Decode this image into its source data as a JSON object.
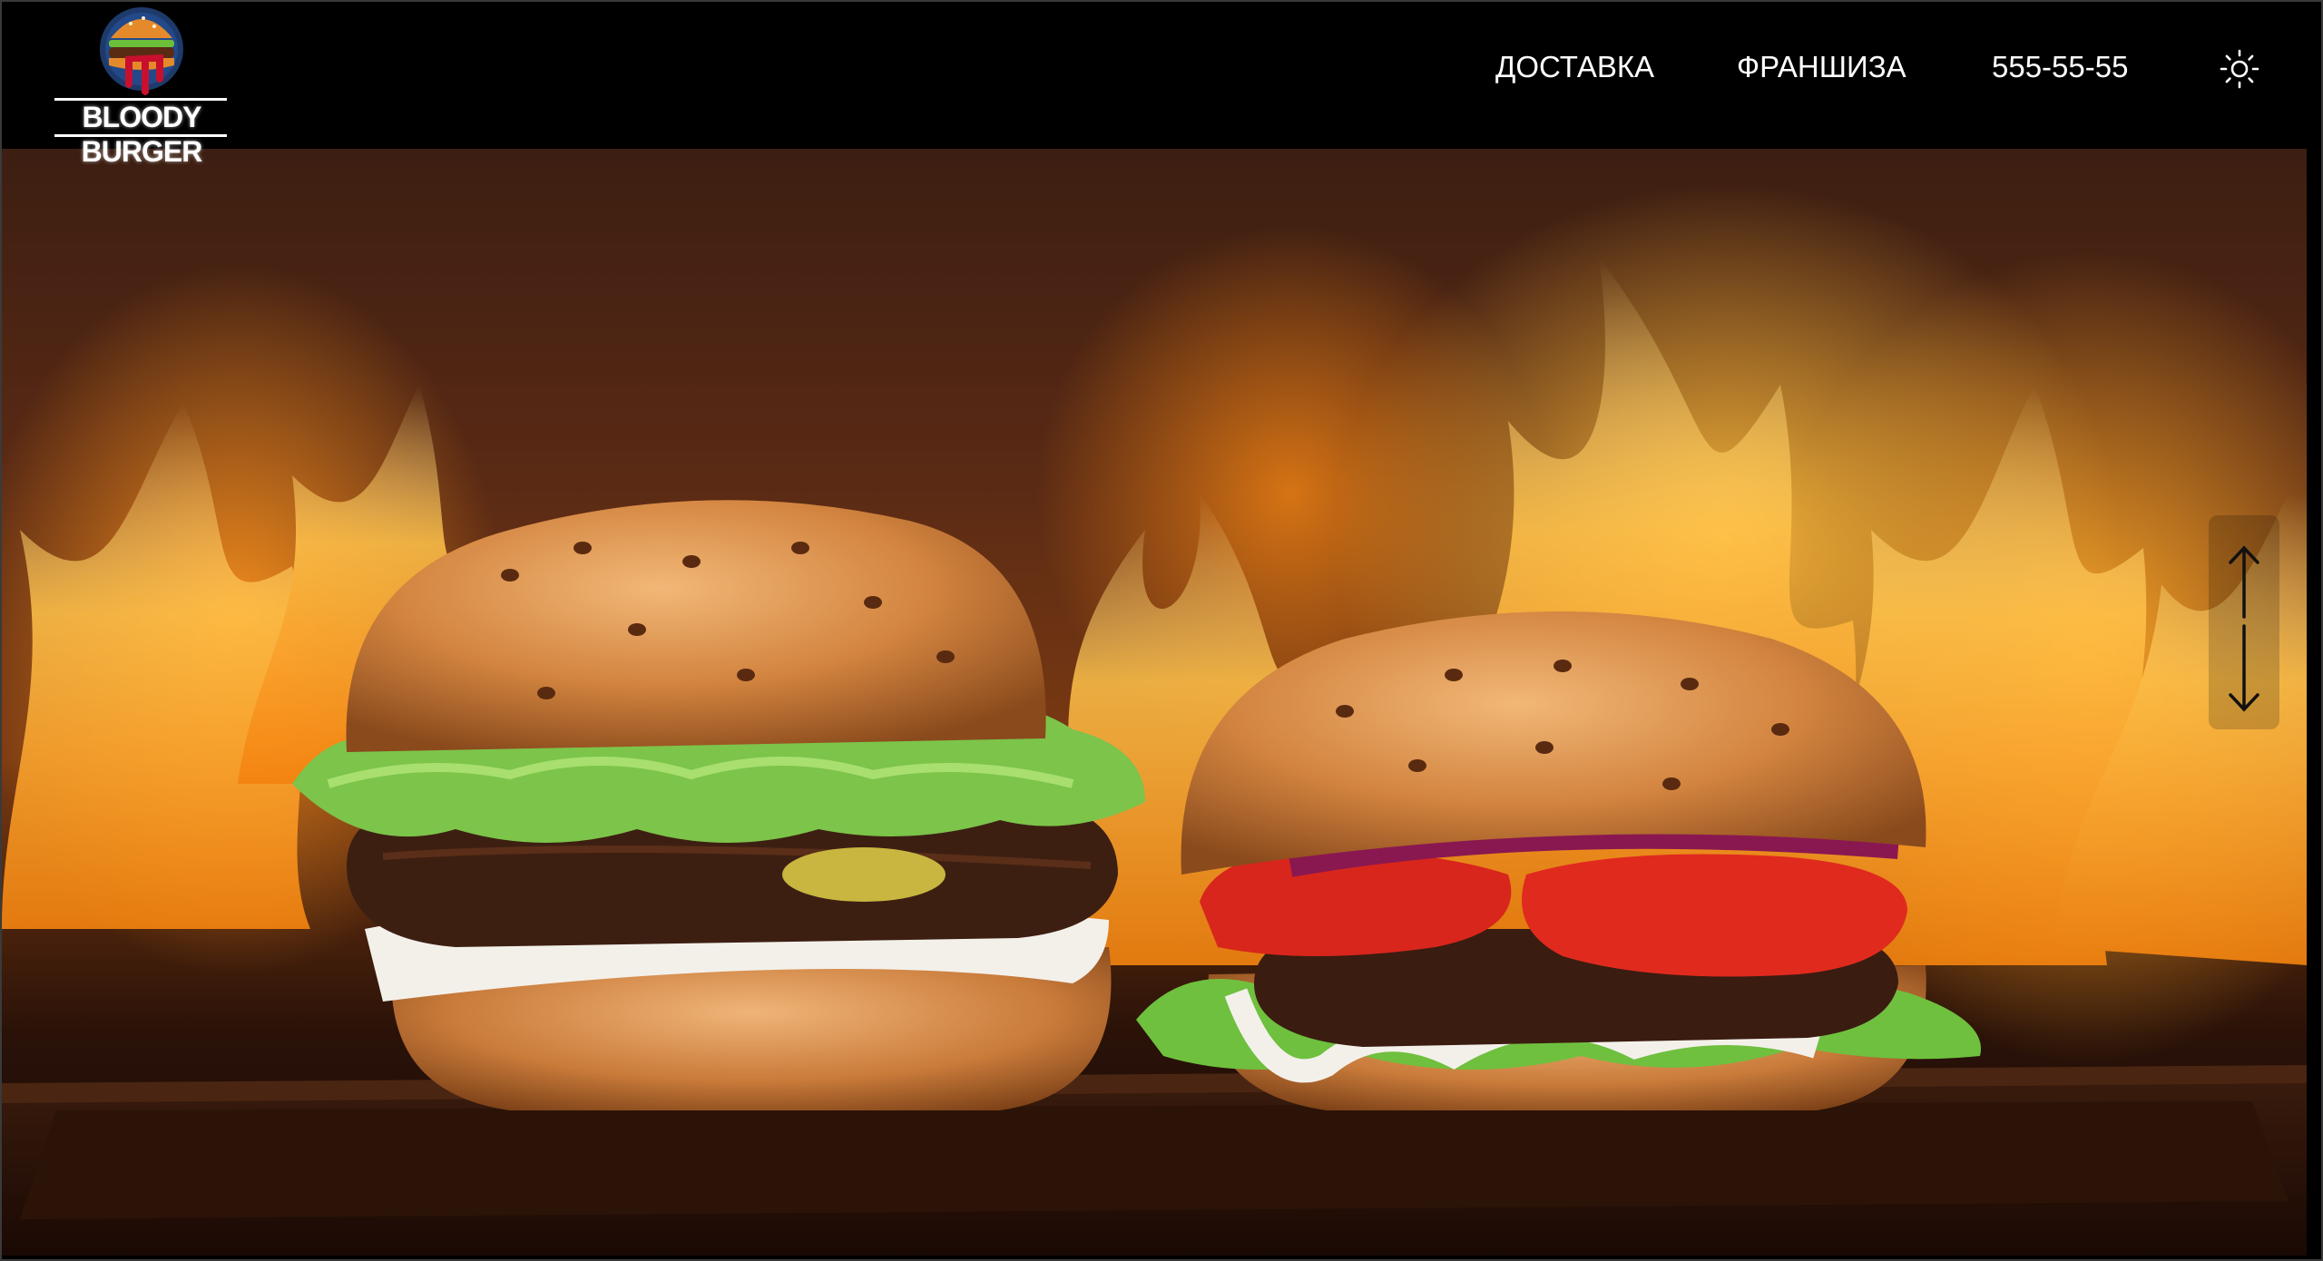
{
  "brand": {
    "name": "BLOODY BURGER",
    "logo_icon": "burger-logo-icon"
  },
  "nav": {
    "delivery": "ДОСТАВКА",
    "franchise": "ФРАНШИЗА",
    "phone": "555-55-55",
    "theme_icon": "sun-icon"
  },
  "hero": {
    "image": "two-burgers-on-wooden-board-with-flames",
    "scroll_up_icon": "arrow-up-icon",
    "scroll_down_icon": "arrow-down-icon"
  },
  "colors": {
    "header_bg": "#000000",
    "nav_text": "#ffffff",
    "flame": "#ff9a1f",
    "logo_red": "#c8102e",
    "logo_navy": "#1d3a6b"
  }
}
